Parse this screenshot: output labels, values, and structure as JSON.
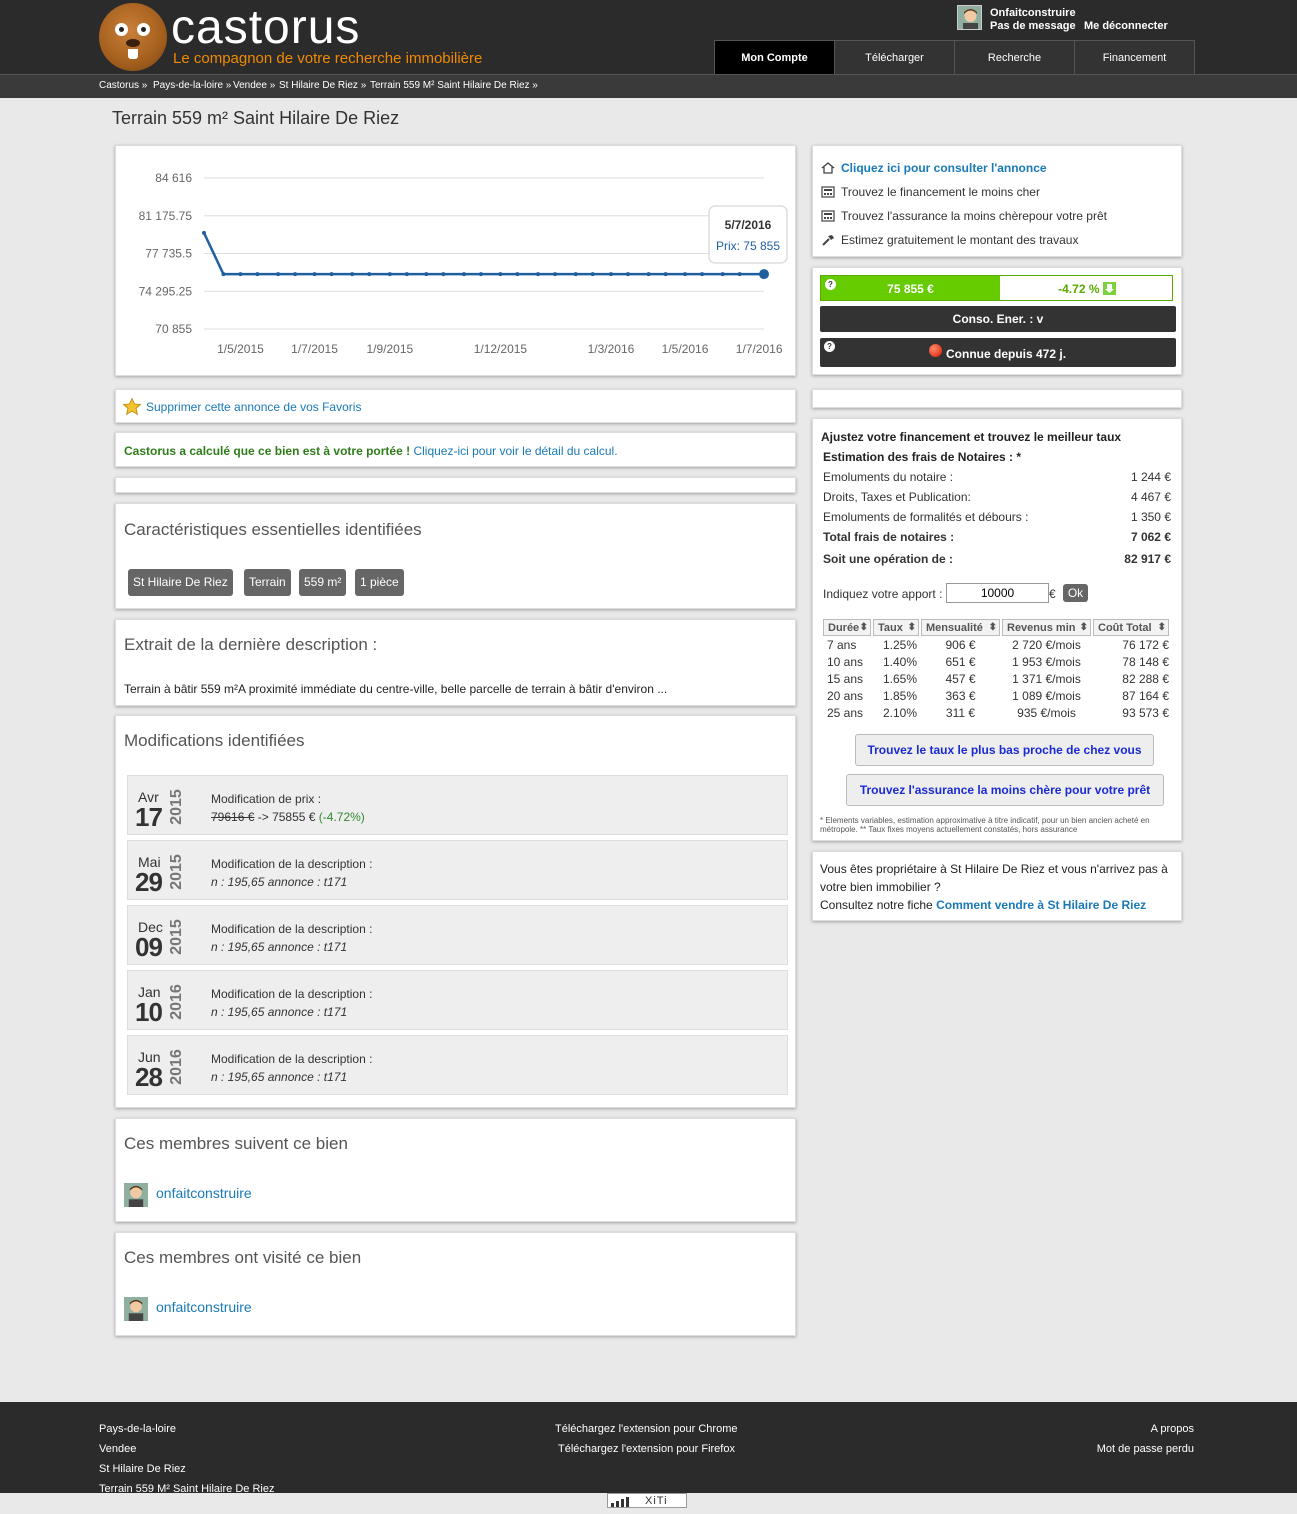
{
  "header": {
    "logo_text": "castorus",
    "tagline": "Le compagnon de votre recherche immobilière",
    "user_name": "Onfaitconstruire",
    "messages": "Pas de message",
    "logout": "Me déconnecter",
    "nav": [
      "Mon Compte",
      "Télécharger",
      "Recherche",
      "Financement"
    ]
  },
  "breadcrumb": [
    "Castorus »",
    "Pays-de-la-loire »",
    "Vendee »",
    "St Hilaire De Riez »",
    "Terrain 559 M² Saint Hilaire De Riez »"
  ],
  "page_title": "Terrain 559 m² Saint Hilaire De Riez",
  "chart_data": {
    "type": "line",
    "y_ticks": [
      "84 616",
      "81 175.75",
      "77 735.5",
      "74 295.25",
      "70 855"
    ],
    "ylim": [
      70855,
      84616
    ],
    "x_ticks": [
      "1/5/2015",
      "1/7/2015",
      "1/9/2015",
      "1/12/2015",
      "1/3/2016",
      "1/5/2016",
      "1/7/2016"
    ],
    "series": [
      {
        "values": [
          {
            "x": "2015-04-01",
            "y": 79616
          },
          {
            "x": "2015-04-17",
            "y": 75855
          },
          {
            "x": "2015-05-01",
            "y": 75855
          },
          {
            "x": "2015-05-15",
            "y": 75855
          },
          {
            "x": "2015-06-01",
            "y": 75855
          },
          {
            "x": "2015-06-15",
            "y": 75855
          },
          {
            "x": "2015-07-01",
            "y": 75855
          },
          {
            "x": "2015-07-15",
            "y": 75855
          },
          {
            "x": "2015-08-01",
            "y": 75855
          },
          {
            "x": "2015-08-15",
            "y": 75855
          },
          {
            "x": "2015-09-01",
            "y": 75855
          },
          {
            "x": "2015-09-15",
            "y": 75855
          },
          {
            "x": "2015-10-01",
            "y": 75855
          },
          {
            "x": "2015-10-15",
            "y": 75855
          },
          {
            "x": "2015-11-01",
            "y": 75855
          },
          {
            "x": "2015-11-15",
            "y": 75855
          },
          {
            "x": "2015-12-01",
            "y": 75855
          },
          {
            "x": "2015-12-15",
            "y": 75855
          },
          {
            "x": "2016-01-01",
            "y": 75855
          },
          {
            "x": "2016-01-15",
            "y": 75855
          },
          {
            "x": "2016-02-01",
            "y": 75855
          },
          {
            "x": "2016-02-15",
            "y": 75855
          },
          {
            "x": "2016-03-01",
            "y": 75855
          },
          {
            "x": "2016-03-15",
            "y": 75855
          },
          {
            "x": "2016-04-01",
            "y": 75855
          },
          {
            "x": "2016-04-15",
            "y": 75855
          },
          {
            "x": "2016-05-01",
            "y": 75855
          },
          {
            "x": "2016-05-15",
            "y": 75855
          },
          {
            "x": "2016-06-01",
            "y": 75855
          },
          {
            "x": "2016-06-15",
            "y": 75855
          },
          {
            "x": "2016-07-05",
            "y": 75855
          }
        ]
      }
    ],
    "tooltip": {
      "date": "5/7/2016",
      "label": "Prix: 75 855"
    },
    "line_color": "#1f5fa0",
    "grid": true
  },
  "favorites": {
    "label": "Supprimer cette annonce de vos Favoris"
  },
  "affordability": {
    "bold": "Castorus a calculé que ce bien est à votre portée !",
    "link": "Cliquez-ici pour voir le détail du calcul."
  },
  "characteristics": {
    "title": "Caractéristiques essentielles identifiées",
    "tags": [
      "St Hilaire De Riez",
      "Terrain",
      "559 m²",
      "1 pièce"
    ]
  },
  "description": {
    "title": "Extrait de la dernière description :",
    "text": "Terrain à bâtir 559 m²A proximité immédiate du centre-ville, belle parcelle de terrain à bâtir d'environ ..."
  },
  "modifications": {
    "title": "Modifications identifiées",
    "items": [
      {
        "month": "Avr",
        "day": "17",
        "year": "2015",
        "label": "Modification de prix :",
        "old": "79616 €",
        "arrow": " -> 75855 € ",
        "pct": "(-4.72%)"
      },
      {
        "month": "Mai",
        "day": "29",
        "year": "2015",
        "label": "Modification de la description :",
        "detail": "n : 195,65 annonce : t171"
      },
      {
        "month": "Dec",
        "day": "09",
        "year": "2015",
        "label": "Modification de la description :",
        "detail": "n : 195,65 annonce : t171"
      },
      {
        "month": "Jan",
        "day": "10",
        "year": "2016",
        "label": "Modification de la description :",
        "detail": "n : 195,65 annonce : t171"
      },
      {
        "month": "Jun",
        "day": "28",
        "year": "2016",
        "label": "Modification de la description :",
        "detail": "n : 195,65 annonce : t171"
      }
    ]
  },
  "followers": {
    "title": "Ces membres suivent ce bien",
    "member": "onfaitconstruire"
  },
  "visitors": {
    "title": "Ces membres ont visité ce bien",
    "member": "onfaitconstruire"
  },
  "links": {
    "annonce": "Cliquez ici pour consulter l'annonce",
    "financement": "Trouvez le financement le moins cher",
    "assurance": "Trouvez l'assurance la moins chèrepour votre prêt",
    "travaux": "Estimez gratuitement le montant des travaux"
  },
  "price_box": {
    "price": "75 855 €",
    "change": "-4.72 %",
    "energy": "Conso. Ener. : v",
    "known": "Connue depuis 472 j.",
    "price_color": "#66cc00",
    "change_color": "#5aaa00"
  },
  "financing": {
    "heading": "Ajustez votre financement et trouvez le meilleur taux",
    "subheading": "Estimation des frais de Notaires : *",
    "rows": [
      {
        "label": "Emoluments du notaire :",
        "value": "1 244 €"
      },
      {
        "label": "Droits, Taxes et Publication:",
        "value": "4 467 €"
      },
      {
        "label": "Emoluments de formalités et débours :",
        "value": "1 350 €"
      }
    ],
    "total_label": "Total frais de notaires :",
    "total_value": "7 062 €",
    "operation_label": "Soit une opération de :",
    "operation_value": "82 917 €",
    "apport_label": "Indiquez votre apport :",
    "apport_value": "10000",
    "apport_currency": "€",
    "ok": "Ok",
    "table_headers": [
      "Durée",
      "Taux",
      "Mensualité",
      "Revenus min",
      "Coût Total"
    ],
    "table_rows": [
      [
        "7 ans",
        "1.25%",
        "906 €",
        "2 720 €/mois",
        "76 172 €"
      ],
      [
        "10 ans",
        "1.40%",
        "651 €",
        "1 953 €/mois",
        "78 148 €"
      ],
      [
        "15 ans",
        "1.65%",
        "457 €",
        "1 371 €/mois",
        "82 288 €"
      ],
      [
        "20 ans",
        "1.85%",
        "363 €",
        "1 089 €/mois",
        "87 164 €"
      ],
      [
        "25 ans",
        "2.10%",
        "311 €",
        "935 €/mois",
        "93 573 €"
      ]
    ],
    "btn_taux": "Trouvez le taux le plus bas proche de chez vous",
    "btn_assurance": "Trouvez l'assurance la moins chère pour votre prêt",
    "footnote": "* Elements variables, estimation approximative à titre indicatif, pour un bien ancien acheté en métropole. ** Taux fixes moyens actuellement constatés, hors assurance"
  },
  "seller": {
    "text": "Vous êtes propriétaire à St Hilaire De Riez et vous n'arrivez pas à votre bien immobilier ?",
    "consult": "Consultez notre fiche",
    "link": "Comment vendre à St Hilaire De Riez"
  },
  "footer": {
    "left": [
      "Pays-de-la-loire",
      "Vendee",
      "St Hilaire De Riez",
      "Terrain 559 M² Saint Hilaire De Riez"
    ],
    "center": [
      "Téléchargez l'extension pour Chrome",
      "Téléchargez l'extension pour Firefox"
    ],
    "right": [
      "A propos",
      "Mot de passe perdu"
    ],
    "xiti": "XiTi"
  }
}
